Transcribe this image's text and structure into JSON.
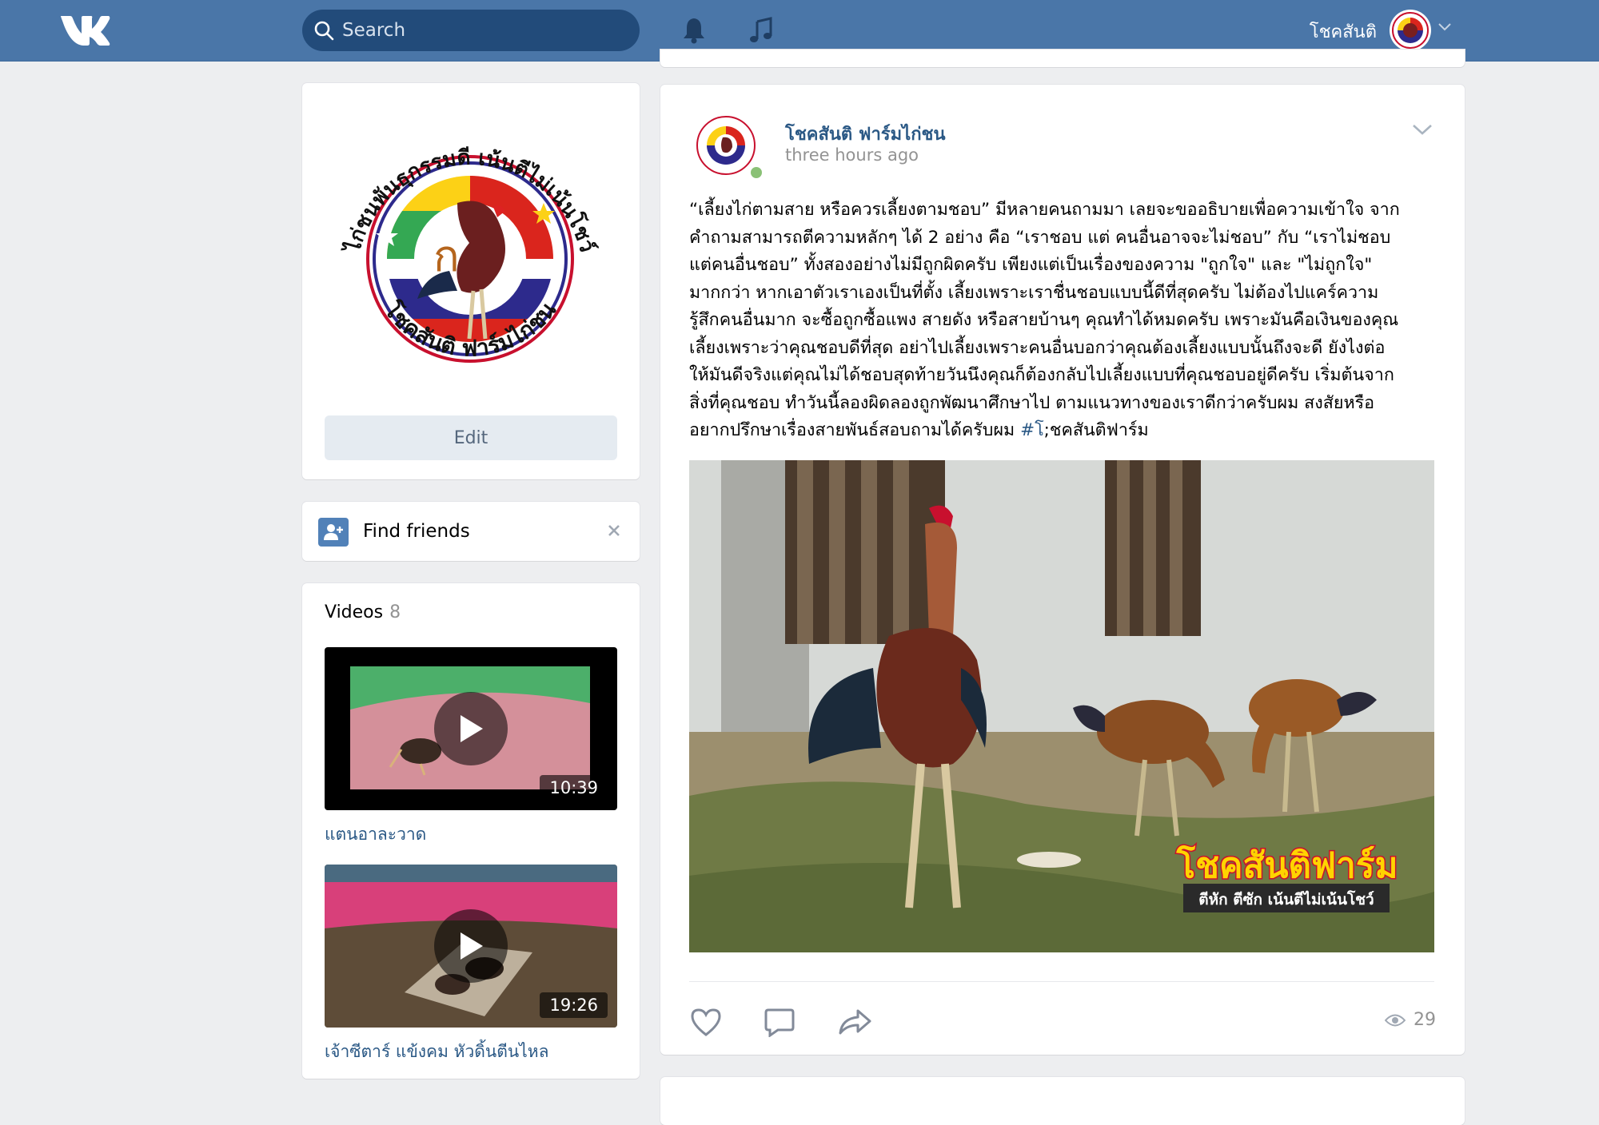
{
  "header": {
    "search_placeholder": "Search",
    "user_name": "โชคสันติ"
  },
  "profile": {
    "logo_text_top": "ไก่ชนพันธุกรรมดี เน้นตีไม่เน้นโชว์",
    "logo_text_bottom": "โชคสันติ ฟาร์มไก่ชน",
    "edit_label": "Edit"
  },
  "find_friends": {
    "label": "Find friends"
  },
  "videos": {
    "title": "Videos",
    "count": "8",
    "items": [
      {
        "title": "แตนอาละวาด",
        "duration": "10:39"
      },
      {
        "title": "เจ้าซีตาร์ แข้งคม หัวดิ้นตีนไหล",
        "duration": "19:26"
      }
    ]
  },
  "post": {
    "author": "โชคสันติ ฟาร์มไก่ชน",
    "time": "three hours ago",
    "text_lines": [
      "“เลี้ยงไก่ตามสาย หรือควรเลี้ยงตามชอบ” มีหลายคนถามมา เลยจะขออธิบายเพื่อความเข้าใจ จาก",
      "คำถามสามารถตีความหลักๆ ได้ 2 อย่าง คือ “เราชอบ แต่ คนอื่นอาจจะไม่ชอบ” กับ “เราไม่ชอบ",
      "แต่คนอื่นชอบ” ทั้งสองอย่างไม่มีถูกผิดครับ เพียงแต่เป็นเรื่องของความ \"ถูกใจ\" และ \"ไม่ถูกใจ\"",
      "มากกว่า หากเอาตัวเราเองเป็นที่ตั้ง เลี้ยงเพราะเราชื่นชอบแบบนี้ดีที่สุดครับ ไม่ต้องไปแคร์ความ",
      "รู้สึกคนอื่นมาก จะซื้อถูกซื้อแพง สายดัง หรือสายบ้านๆ คุณทำได้หมดครับ เพราะมันคือเงินของคุณ",
      "เลี้ยงเพราะว่าคุณชอบดีที่สุด อย่าไปเลี้ยงเพราะคนอื่นบอกว่าคุณต้องเลี้ยงแบบนั้นถึงจะดี ยังไงต่อ",
      "ให้มันดีจริงแต่คุณไม่ได้ชอบสุดท้ายวันนึงคุณก็ต้องกลับไปเลี้ยงแบบที่คุณชอบอยู่ดีครับ เริ่มต้นจาก",
      "สิ่งที่คุณชอบ ทำวันนี้ลองผิดลองถูกพัฒนาศึกษาไป ตามแนวทางของเราดีกว่าครับผม สงสัยหรือ"
    ],
    "text_last_prefix": "อยากปรึกษาเรื่องสายพันธ์สอบถามได้ครับผม ",
    "hashtag": "#โ",
    "text_last_suffix": ";ชคสันติฟาร์ม",
    "photo_logo_main": "โชคสันติฟาร์ม",
    "photo_logo_sub": "ตีหัก ตีซัก เน้นตีไม่เน้นโชว์",
    "views": "29"
  },
  "colors": {
    "header_bg": "#4a76a8",
    "link": "#2a5885",
    "page_bg": "#edeef0"
  }
}
